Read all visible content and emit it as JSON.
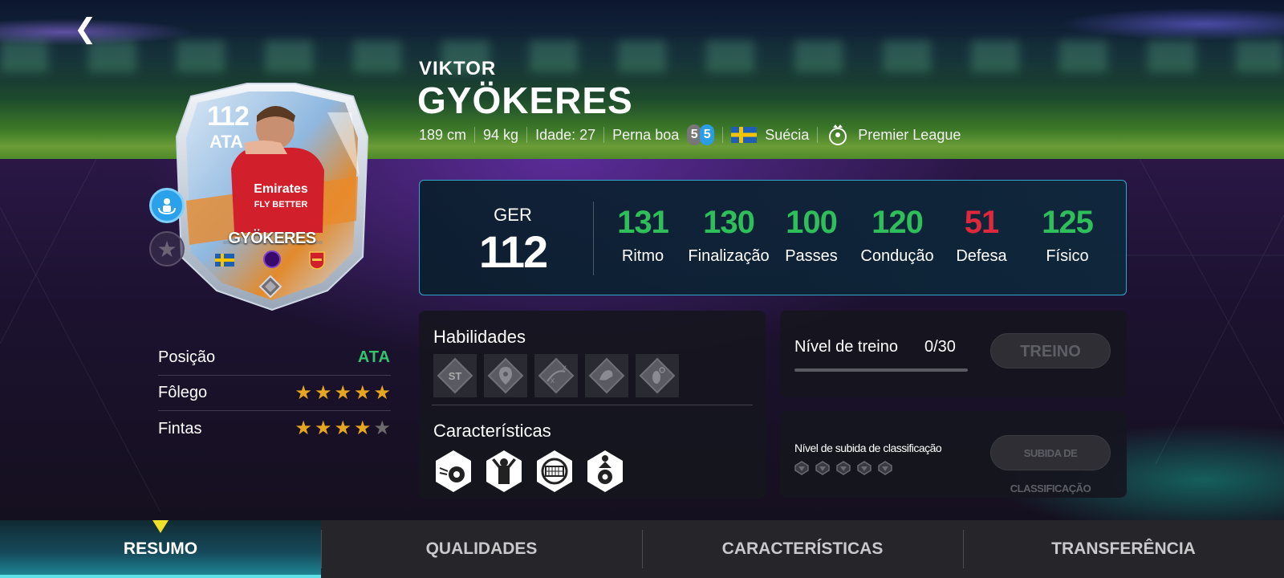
{
  "nav": {
    "back_icon": "chevron-left-icon",
    "back_glyph": "❮"
  },
  "player": {
    "first_name": "VIKTOR",
    "last_name": "GYÖKERES",
    "height": "189 cm",
    "weight": "94 kg",
    "age": "Idade: 27",
    "strong_foot_label": "Perna boa",
    "weak_foot": "5",
    "strong_foot": "5",
    "nation": "Suécia",
    "league": "Premier League"
  },
  "card": {
    "rating": "112",
    "position": "ATA",
    "name": "GYÖKERES",
    "club_icon": "arsenal-crest-icon",
    "league_icon": "premier-league-icon",
    "nation_icon": "sweden-flag-icon",
    "gem_icon": "diamond-icon"
  },
  "stats": {
    "overall_label": "GER",
    "overall_value": "112",
    "items": [
      {
        "name": "Ritmo",
        "value": "131",
        "color": "#2fbf5a"
      },
      {
        "name": "Finalização",
        "value": "130",
        "color": "#2fbf5a"
      },
      {
        "name": "Passes",
        "value": "100",
        "color": "#2fbf5a"
      },
      {
        "name": "Condução",
        "value": "120",
        "color": "#2fbf5a"
      },
      {
        "name": "Defesa",
        "value": "51",
        "color": "#e0283c"
      },
      {
        "name": "Físico",
        "value": "125",
        "color": "#2fbf5a"
      }
    ]
  },
  "attributes": {
    "position_label": "Posição",
    "position_value": "ATA",
    "stamina_label": "Fôlego",
    "stamina_stars": 5,
    "skill_moves_label": "Fintas",
    "skill_moves_stars": 4,
    "star_max": 5
  },
  "skills": {
    "title": "Habilidades",
    "icons": [
      "st-badge-icon",
      "location-pin-icon",
      "tactics-board-icon",
      "flexed-arm-icon",
      "foot-icon"
    ],
    "st_text": "ST"
  },
  "traits": {
    "title": "Características",
    "icons": [
      "ball-power-shot-icon",
      "celebrating-player-icon",
      "goal-net-icon",
      "ball-header-icon"
    ]
  },
  "training": {
    "label": "Nível de treino",
    "value": "0/30",
    "progress": 0,
    "button": "TREINO"
  },
  "rank_up": {
    "label": "Nível de subida de classificação",
    "levels": 5,
    "button": "SUBIDA DE CLASSIFICAÇÃO"
  },
  "tabs": [
    {
      "label": "RESUMO",
      "active": true
    },
    {
      "label": "QUALIDADES",
      "active": false
    },
    {
      "label": "CARACTERÍSTICAS",
      "active": false
    },
    {
      "label": "TRANSFERÊNCIA",
      "active": false
    }
  ],
  "colors": {
    "accent_green": "#34c46a",
    "panel_border": "#2fa8c8",
    "star_gold": "#e7a620"
  }
}
